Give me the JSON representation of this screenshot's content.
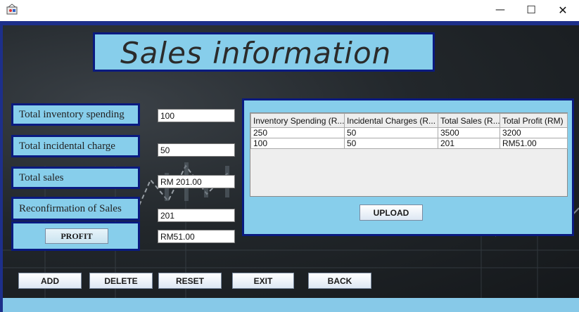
{
  "window": {
    "minimize_glyph": "—",
    "maximize_glyph": "☐",
    "close_glyph": "✕"
  },
  "header": {
    "title": "Sales information"
  },
  "form": {
    "fields": [
      {
        "label": "Total inventory spending",
        "value": "100"
      },
      {
        "label": "Total incidental charge",
        "value": "50"
      },
      {
        "label": "Total sales",
        "value": "RM 201.00"
      },
      {
        "label": "Reconfirmation of Sales",
        "value": "201"
      }
    ],
    "profit_button": "PROFIT",
    "profit_value": "RM51.00"
  },
  "table": {
    "columns": [
      "Inventory Spending (R...",
      "Incidental Charges (R...",
      "Total Sales (R...",
      "Total Profit (RM)"
    ],
    "rows": [
      [
        "250",
        "50",
        "3500",
        "3200"
      ],
      [
        "100",
        "50",
        "201",
        "RM51.00"
      ]
    ],
    "upload_button": "UPLOAD"
  },
  "actions": {
    "add": "ADD",
    "delete": "DELETE",
    "reset": "RESET",
    "exit": "EXIT",
    "back": "BACK"
  },
  "colors": {
    "panel": "#87ceeb",
    "border": "#0a1a80",
    "background_dark": "#22272b"
  }
}
